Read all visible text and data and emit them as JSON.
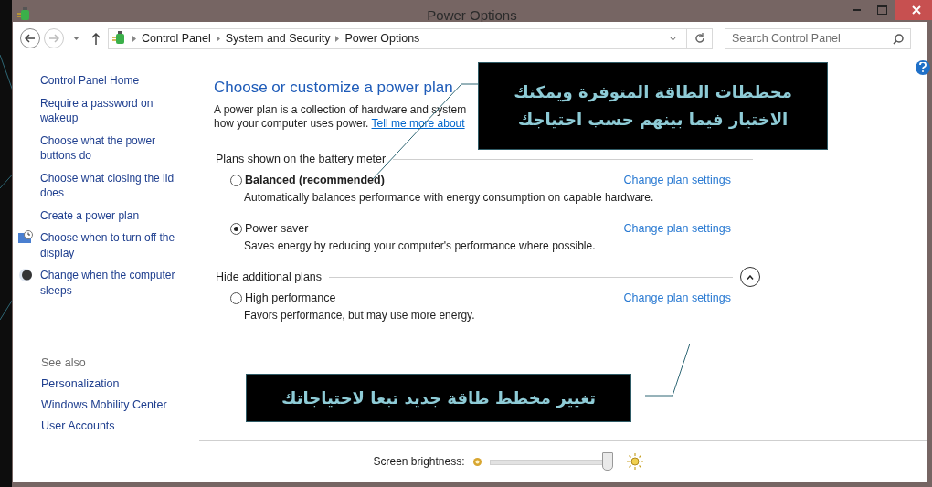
{
  "window": {
    "title": "Power Options"
  },
  "address_bar": {
    "breadcrumbs": [
      "Control Panel",
      "System and Security",
      "Power Options"
    ],
    "search": {
      "placeholder": "Search Control Panel"
    }
  },
  "sidebar": {
    "links": [
      {
        "label": "Control Panel Home",
        "kind": "plain"
      },
      {
        "label": "Require a password on wakeup",
        "kind": "plain"
      },
      {
        "label": "Choose what the power buttons do",
        "kind": "plain"
      },
      {
        "label": "Choose what closing the lid does",
        "kind": "plain"
      },
      {
        "label": "Create a power plan",
        "kind": "plain"
      },
      {
        "label": "Choose when to turn off the display",
        "kind": "display"
      },
      {
        "label": "Change when the computer sleeps",
        "kind": "sleep"
      }
    ],
    "see_also": {
      "heading": "See also",
      "links": [
        "Personalization",
        "Windows Mobility Center",
        "User Accounts"
      ]
    }
  },
  "main": {
    "heading": "Choose or customize a power plan",
    "description_lines": [
      "A power plan is a collection of hardware and system",
      "how your computer uses power."
    ],
    "description_link": "Tell me more about",
    "sections": [
      {
        "title": "Plans shown on the battery meter",
        "kind": "fixed",
        "plans": [
          {
            "name": "Balanced (recommended)",
            "recommended": true,
            "selected": false,
            "description": "Automatically balances performance with energy consumption on capable hardware.",
            "link": "Change plan settings"
          },
          {
            "name": "Power saver",
            "recommended": false,
            "selected": true,
            "description": "Saves energy by reducing your computer's performance where possible.",
            "link": "Change plan settings"
          }
        ]
      },
      {
        "title": "Hide additional plans",
        "kind": "collapsible",
        "expanded": true,
        "plans": [
          {
            "name": "High performance",
            "recommended": false,
            "selected": false,
            "description": "Favors performance, but may use more energy.",
            "link": "Change plan settings"
          }
        ]
      }
    ]
  },
  "annotations": [
    {
      "lines": [
        "مخططات الطاقة المتوفرة ويمكنك",
        "الاختيار فيما بينهم حسب احتياجك"
      ]
    },
    {
      "lines": [
        "تغيير مخطط طاقة جديد تبعا لاحتياجاتك"
      ]
    }
  ],
  "brightness": {
    "label": "Screen brightness:",
    "level": 0.95
  }
}
